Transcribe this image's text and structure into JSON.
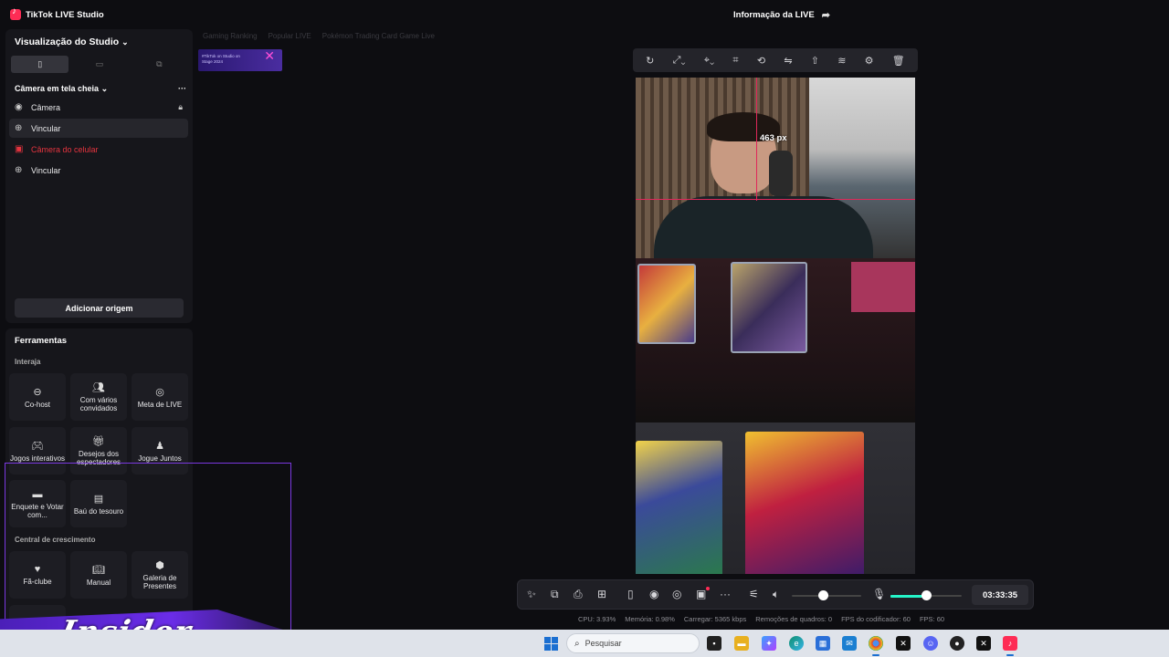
{
  "app": {
    "title": "TikTok LIVE Studio",
    "live_info": "Informação da LIVE"
  },
  "studio": {
    "title": "Visualização do Studio",
    "orientations": [
      "portrait",
      "landscape",
      "dual"
    ],
    "scene": "Câmera em tela cheia",
    "sources": [
      {
        "label": "Câmera",
        "icon": "camera-icon",
        "locked": true
      },
      {
        "label": "Vincular",
        "icon": "globe-icon",
        "selected": true
      },
      {
        "label": "Câmera do celular",
        "icon": "phone-camera-icon",
        "error": true
      },
      {
        "label": "Vincular",
        "icon": "globe-icon"
      }
    ],
    "add_source": "Adicionar origem"
  },
  "tools": {
    "title": "Ferramentas",
    "interact_label": "Interaja",
    "growth_label": "Central de crescimento",
    "interact": [
      {
        "label": "Co-host",
        "icon": "link-icon"
      },
      {
        "label": "Com vários convidados",
        "icon": "multi-guest-icon"
      },
      {
        "label": "Meta de LIVE",
        "icon": "goal-icon"
      },
      {
        "label": "Jogos interativos",
        "icon": "gamepad-icon"
      },
      {
        "label": "Desejos dos espectadores",
        "icon": "gift-icon"
      },
      {
        "label": "Jogue Juntos",
        "icon": "joystick-icon"
      },
      {
        "label": "Enquete e Votar com...",
        "icon": "poll-icon"
      },
      {
        "label": "Baú do tesouro",
        "icon": "chest-icon"
      }
    ],
    "growth": [
      {
        "label": "Fã-clube",
        "icon": "heart-icon"
      },
      {
        "label": "Manual",
        "icon": "book-icon"
      },
      {
        "label": "Galeria de Presentes",
        "icon": "gallery-icon"
      }
    ]
  },
  "chips": [
    "Gaming Ranking",
    "Popular LIVE",
    "Pokémon Trading Card Game Live"
  ],
  "thumbnail_text": "#TikTok on Studio on Stage 2024",
  "preview": {
    "guide_label": "463 px"
  },
  "controls": {
    "timer": "03:33:35",
    "volume_level": 0.45,
    "mic_level": 0.5
  },
  "stats": {
    "cpu": "CPU: 3.93%",
    "memory": "Memória: 0.98%",
    "upload": "Carregar: 5365 kbps",
    "dropped": "Remoções de quadros: 0",
    "encoder_fps": "FPS do codificador: 60",
    "fps": "FPS: 60"
  },
  "taskbar": {
    "search_placeholder": "Pesquisar"
  },
  "overlay": {
    "brand": "Insider"
  },
  "colors": {
    "accent": "#fe2c55",
    "mic_level": "#25f4c8",
    "overlay": "#6a2ce8"
  }
}
